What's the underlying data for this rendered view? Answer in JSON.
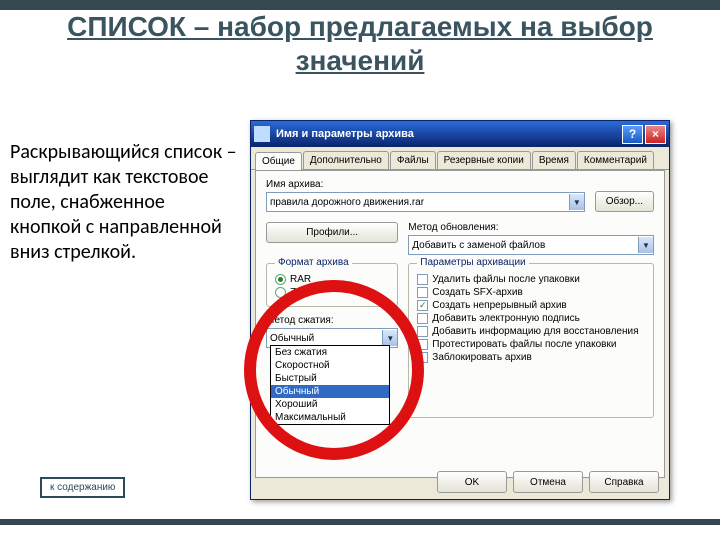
{
  "slide": {
    "title": "СПИСОК – набор предлагаемых на выбор значений",
    "body": "Раскрывающийся список – выглядит как текстовое поле, снабженное кнопкой с направленной вниз стрелкой.",
    "toc_button": "к содержанию"
  },
  "dialog": {
    "title": "Имя и параметры архива",
    "close": "×",
    "help": "?",
    "tabs": [
      "Общие",
      "Дополнительно",
      "Файлы",
      "Резервные копии",
      "Время",
      "Комментарий"
    ],
    "archive_name_label": "Имя архива:",
    "archive_name_value": "правила дорожного движения.rar",
    "browse_btn": "Обзор...",
    "profiles_btn": "Профили...",
    "update_method_label": "Метод обновления:",
    "update_method_value": "Добавить с заменой файлов",
    "format_group": "Формат архива",
    "format_rar": "RAR",
    "format_zip": "ZIP",
    "compression_label": "Метод сжатия:",
    "compression_value": "Обычный",
    "compression_options": [
      "Без сжатия",
      "Скоростной",
      "Быстрый",
      "Обычный",
      "Хороший",
      "Максимальный"
    ],
    "params_group": "Параметры архивации",
    "opt_delete": "Удалить файлы после упаковки",
    "opt_sfx": "Создать SFX-архив",
    "opt_solid": "Создать непрерывный архив",
    "opt_sign": "Добавить электронную подпись",
    "opt_recovery": "Добавить информацию для восстановления",
    "opt_test": "Протестировать файлы после упаковки",
    "opt_lock": "Заблокировать архив",
    "ok": "OK",
    "cancel": "Отмена",
    "help_btn": "Справка"
  }
}
